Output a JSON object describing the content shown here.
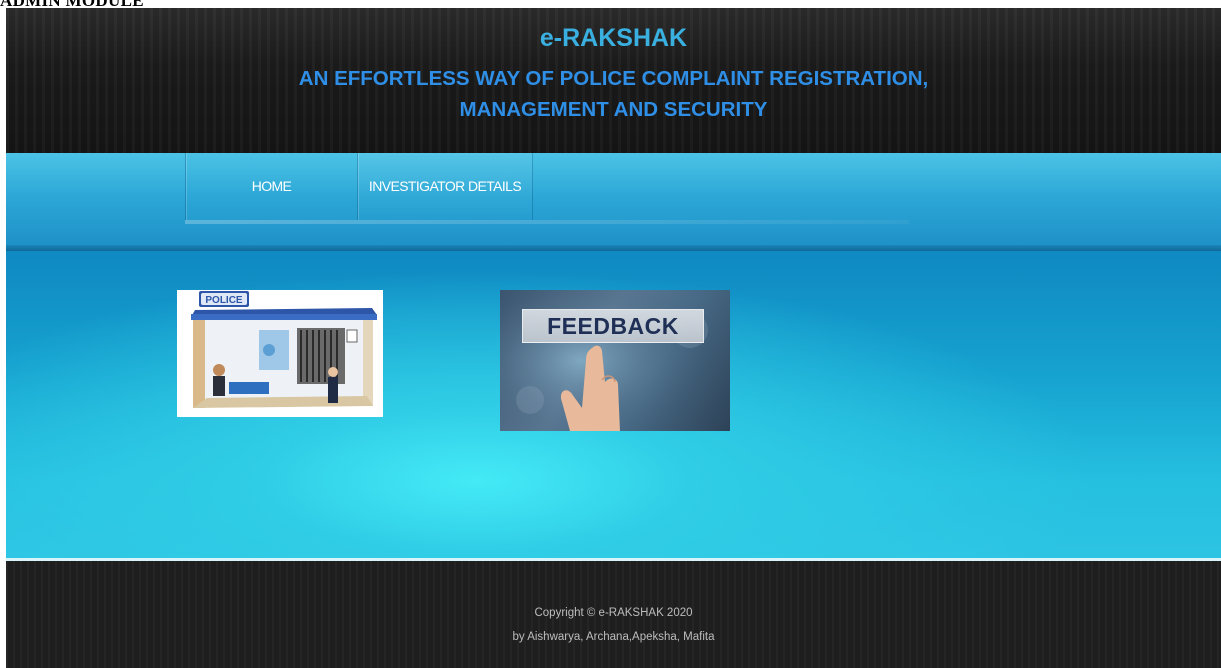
{
  "doc_caption": "ADMIN MODULE",
  "header": {
    "brand": "e-RAKSHAK",
    "tagline_line1": "AN EFFORTLESS WAY OF POLICE COMPLAINT REGISTRATION,",
    "tagline_line2": "MANAGEMENT AND SECURITY"
  },
  "nav": {
    "items": [
      {
        "label": "HOME"
      },
      {
        "label": "INVESTIGATOR DETAILS"
      }
    ]
  },
  "tiles": {
    "police": {
      "sign": "POLICE",
      "icon": "police-station-icon"
    },
    "feedback": {
      "label": "FEEDBACK",
      "icon": "pointing-hand-icon"
    }
  },
  "footer": {
    "copyright": "Copyright © e-RAKSHAK 2020",
    "credits": "by Aishwarya, Archana,Apeksha, Mafita"
  },
  "colors": {
    "brand": "#3ab0e0",
    "tagline": "#2f8fe6",
    "nav": "#2ca7d6",
    "main_glow": "#44eaf6",
    "footer": "#1e1e1e"
  }
}
